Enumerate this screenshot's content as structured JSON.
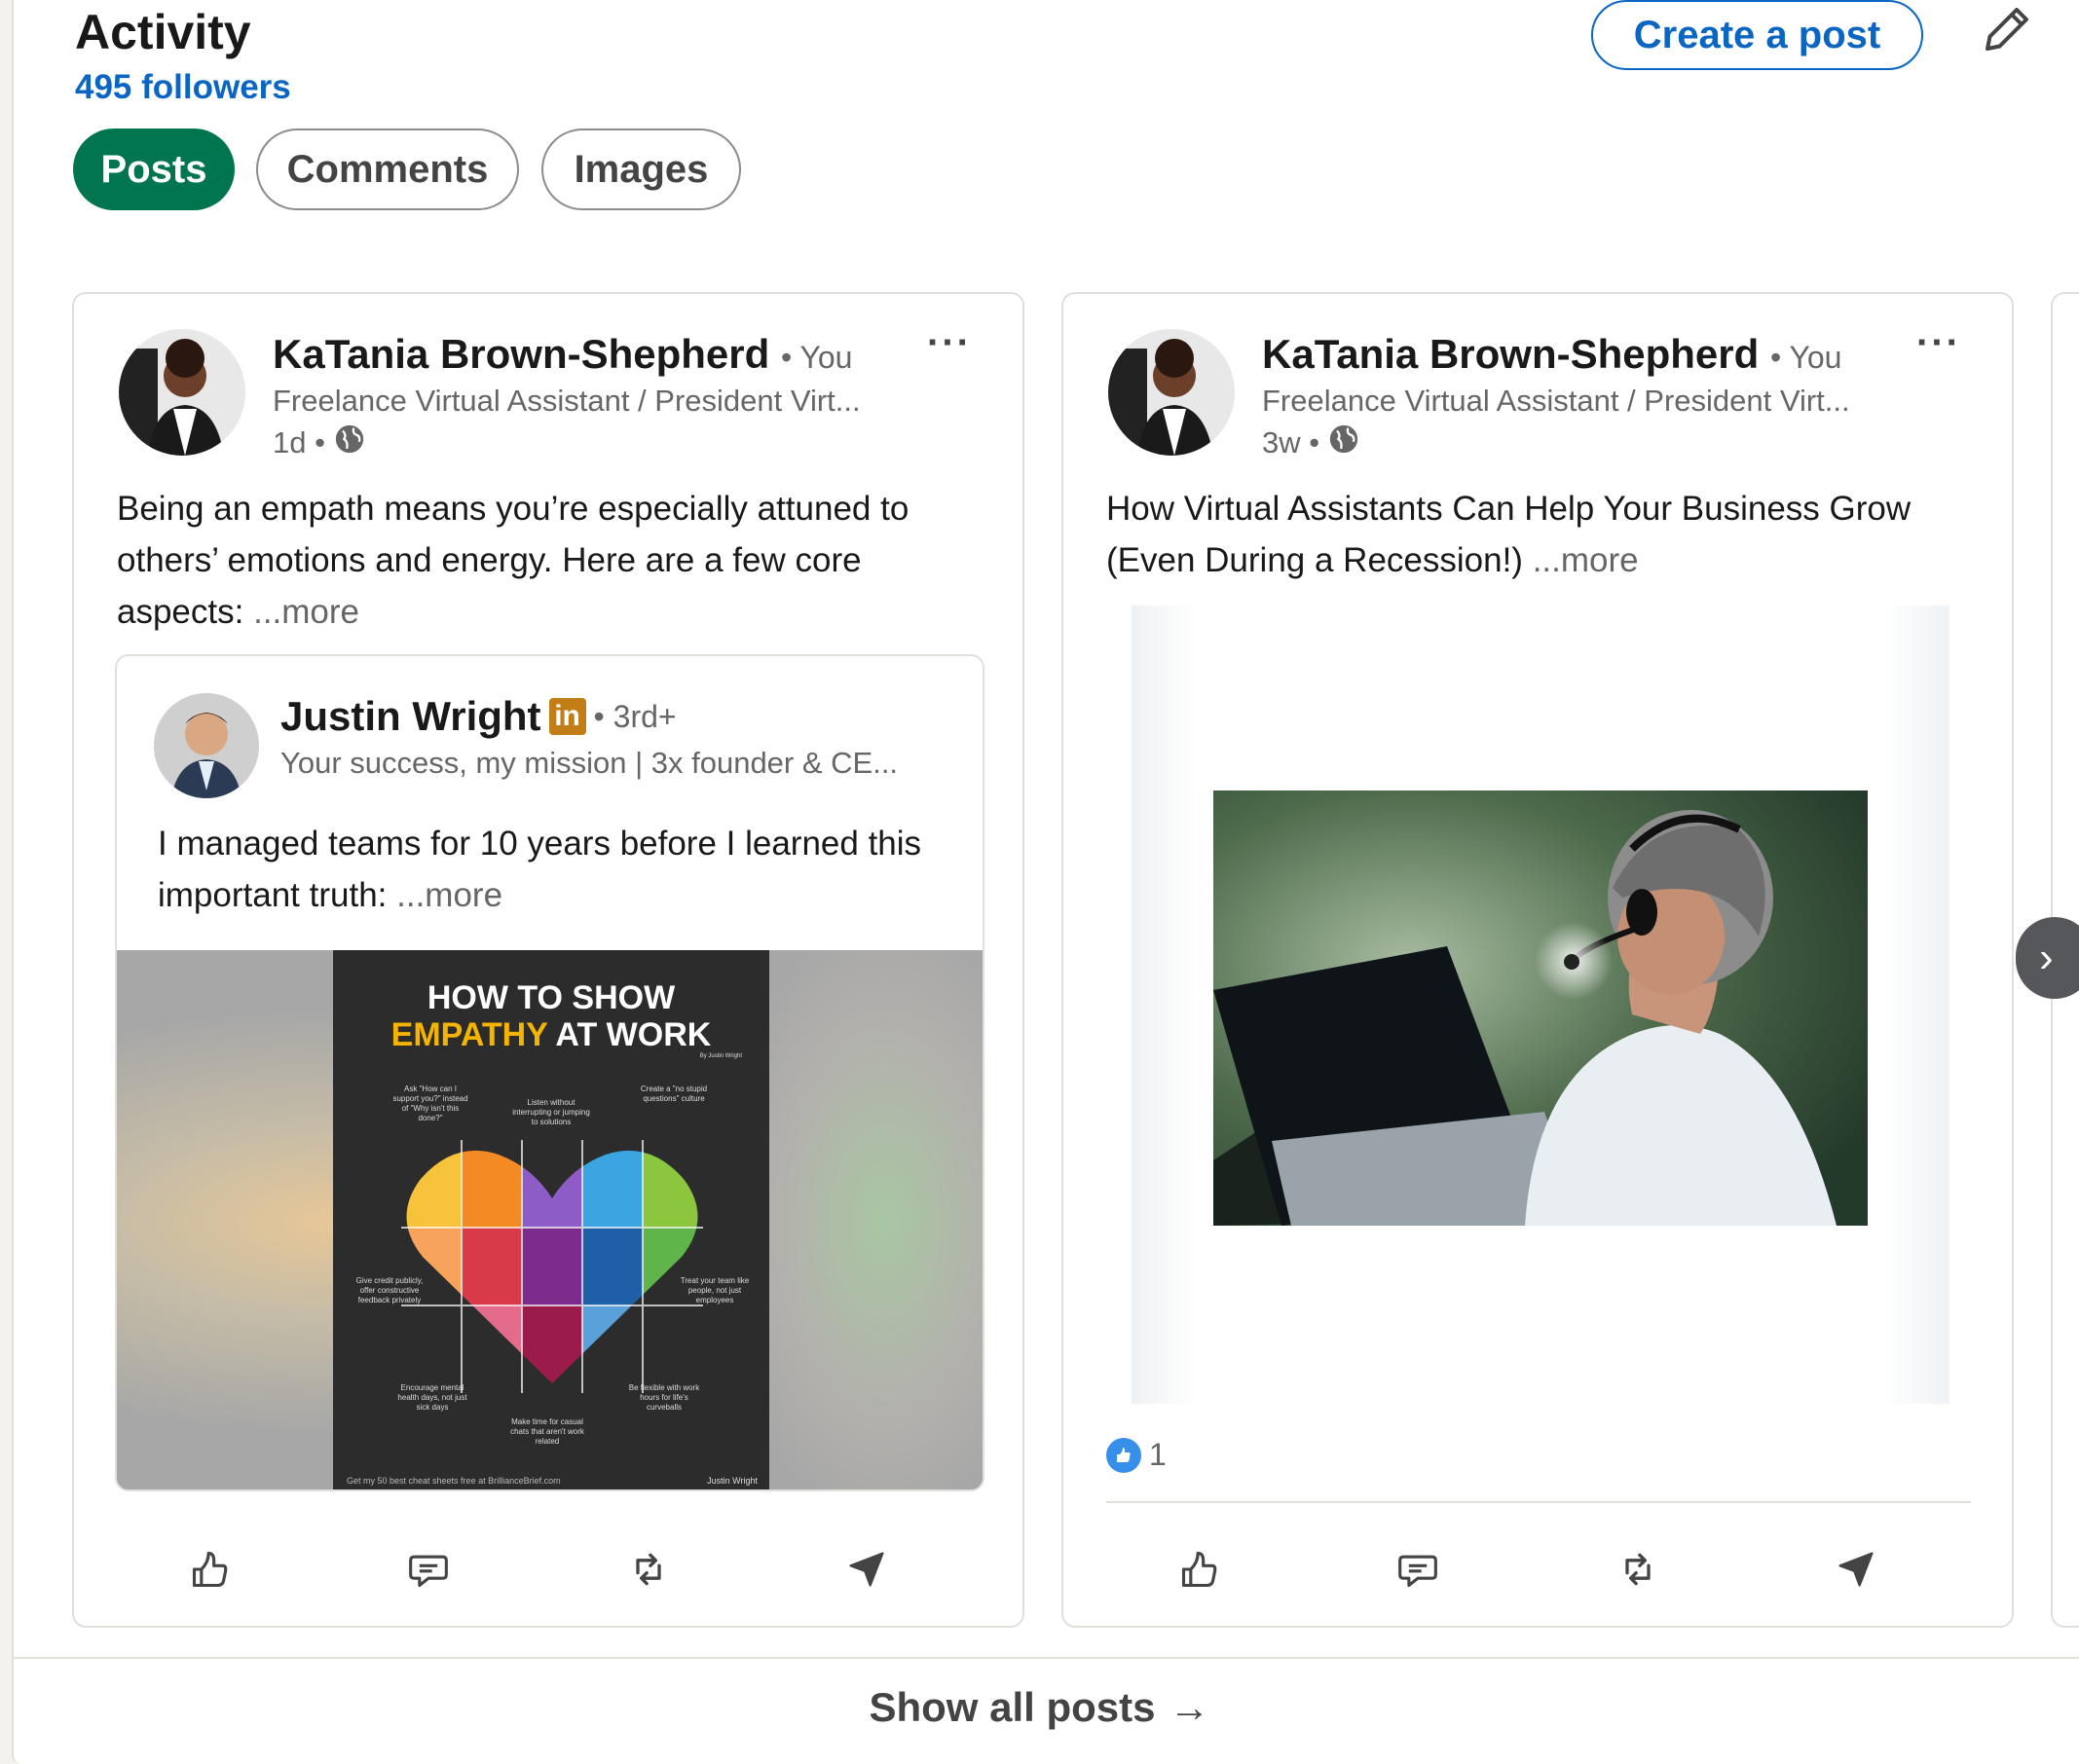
{
  "section": {
    "title": "Activity",
    "followers": "495 followers",
    "create_post_label": "Create a post",
    "edit_icon": "pencil-icon"
  },
  "tabs": [
    {
      "label": "Posts",
      "active": true
    },
    {
      "label": "Comments",
      "active": false
    },
    {
      "label": "Images",
      "active": false
    }
  ],
  "posts": [
    {
      "author": "KaTania Brown-Shepherd",
      "relation": "• You",
      "headline": "Freelance Virtual Assistant / President Virt...",
      "time": "1d •",
      "text": "Being an empath means you’re especially attuned to others’ emotions and energy. Here are a few core aspects:",
      "more": "...more",
      "reshared": {
        "author": "Justin Wright",
        "badge": "in",
        "degree": "• 3rd+",
        "headline": "Your success, my mission | 3x founder & CE...",
        "text": "I managed teams for 10 years before I learned this important truth:",
        "more": "...more",
        "image": {
          "title_line1": "HOW TO SHOW",
          "title_line2_highlight": "EMPATHY",
          "title_line2_rest": " AT WORK",
          "byline": "By Justin Wright",
          "tips": [
            "Ask \"How can I support you?\" instead of \"Why isn't this done?\"",
            "Listen without interrupting or jumping to solutions",
            "Create a \"no stupid questions\" culture",
            "Give credit publicly, offer constructive feedback privately",
            "Treat your team like people, not just employees",
            "Encourage mental health days, not just sick days",
            "Be flexible with work hours for life's curveballs",
            "Make time for casual chats that aren't work related"
          ],
          "footer_left": "Get my 50 best cheat sheets free at BrillianceBrief.com",
          "footer_right": "Justin Wright"
        }
      }
    },
    {
      "author": "KaTania Brown-Shepherd",
      "relation": "• You",
      "headline": "Freelance Virtual Assistant / President Virt...",
      "time": "3w •",
      "text": "How Virtual Assistants Can Help Your Business Grow (Even During a Recession!)",
      "more": "...more",
      "reaction_count": "1"
    }
  ],
  "actions": [
    "like-icon",
    "comment-icon",
    "repost-icon",
    "send-icon"
  ],
  "footer": {
    "show_all": "Show all posts",
    "arrow": "→"
  },
  "colors": {
    "brand_blue": "#0a66c2",
    "active_tab": "#01754f",
    "badge_gold": "#c37d16"
  }
}
